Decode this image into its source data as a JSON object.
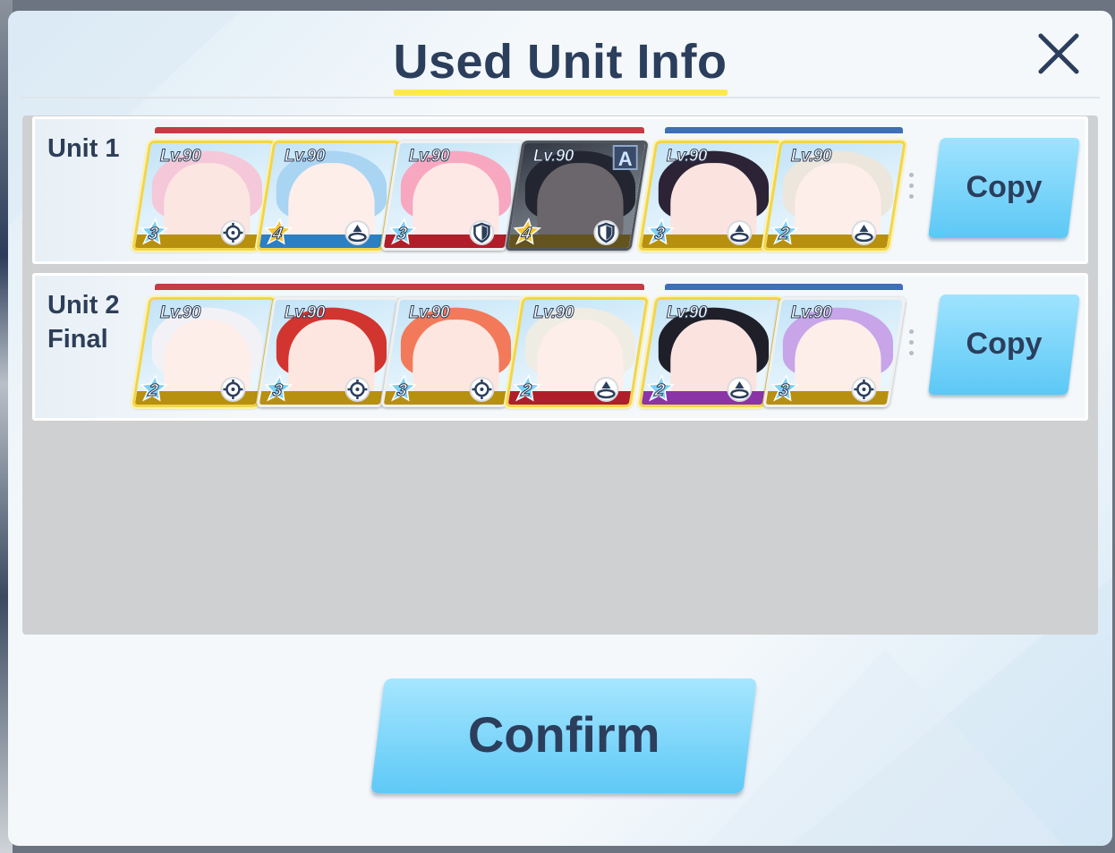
{
  "dialog": {
    "title": "Used Unit Info",
    "confirm_label": "Confirm",
    "close_icon": "close-x-icon"
  },
  "units": [
    {
      "label": "Unit 1",
      "sublabel": "",
      "copy_label": "Copy",
      "students": [
        {
          "level": "Lv.90",
          "stars": "3",
          "role_icon": "crosshair-icon",
          "frame": "gold",
          "bar": "#b8900f",
          "hair": "#f4c8d8",
          "face": "#fbe6e2"
        },
        {
          "level": "Lv.90",
          "stars": "4",
          "role_icon": "support-icon",
          "frame": "gold",
          "bar": "#2c7fc2",
          "hair": "#a9d4f2",
          "face": "#fdeeea"
        },
        {
          "level": "Lv.90",
          "stars": "3",
          "role_icon": "shield-icon",
          "frame": "white",
          "bar": "#b01e2a",
          "hair": "#f7a8c0",
          "face": "#fde8e6"
        },
        {
          "level": "Lv.90",
          "stars": "4",
          "role_icon": "shield-icon",
          "frame": "dark",
          "bar": "#b8900f",
          "hair": "#2a2a34",
          "face": "#c9b8b6",
          "dimmed": true,
          "badge": "A"
        },
        {
          "level": "Lv.90",
          "stars": "3",
          "role_icon": "support-icon",
          "frame": "gold",
          "bar": "#b8900f",
          "hair": "#2c2336",
          "face": "#fbe4e0"
        },
        {
          "level": "Lv.90",
          "stars": "2",
          "role_icon": "support-icon",
          "frame": "gold",
          "bar": "#b8900f",
          "hair": "#ece6dc",
          "face": "#fdeeea"
        }
      ]
    },
    {
      "label": "Unit 2",
      "sublabel": "Final",
      "copy_label": "Copy",
      "students": [
        {
          "level": "Lv.90",
          "stars": "2",
          "role_icon": "crosshair-icon",
          "frame": "gold",
          "bar": "#b8900f",
          "hair": "#f1f1f6",
          "face": "#fdeeea"
        },
        {
          "level": "Lv.90",
          "stars": "3",
          "role_icon": "crosshair-icon",
          "frame": "white",
          "bar": "#b8900f",
          "hair": "#d2352f",
          "face": "#fde6e0"
        },
        {
          "level": "Lv.90",
          "stars": "3",
          "role_icon": "crosshair-icon",
          "frame": "white",
          "bar": "#b8900f",
          "hair": "#f27a5a",
          "face": "#fde6e0"
        },
        {
          "level": "Lv.90",
          "stars": "2",
          "role_icon": "support-icon",
          "frame": "gold",
          "bar": "#b01e2a",
          "hair": "#efece4",
          "face": "#fdeeea"
        },
        {
          "level": "Lv.90",
          "stars": "2",
          "role_icon": "support-icon",
          "frame": "gold",
          "bar": "#8b34a8",
          "hair": "#1f1f2a",
          "face": "#fbe4e0"
        },
        {
          "level": "Lv.90",
          "stars": "3",
          "role_icon": "crosshair-icon",
          "frame": "white",
          "bar": "#b8900f",
          "hair": "#c8a4e8",
          "face": "#fdeeea"
        }
      ]
    }
  ],
  "colors": {
    "title": "#2b3e5c",
    "accent_yellow": "#ffe94a",
    "button_blue": "#5cc8f5",
    "striker_bar": "#c43c44",
    "special_bar": "#3f6fb6"
  }
}
